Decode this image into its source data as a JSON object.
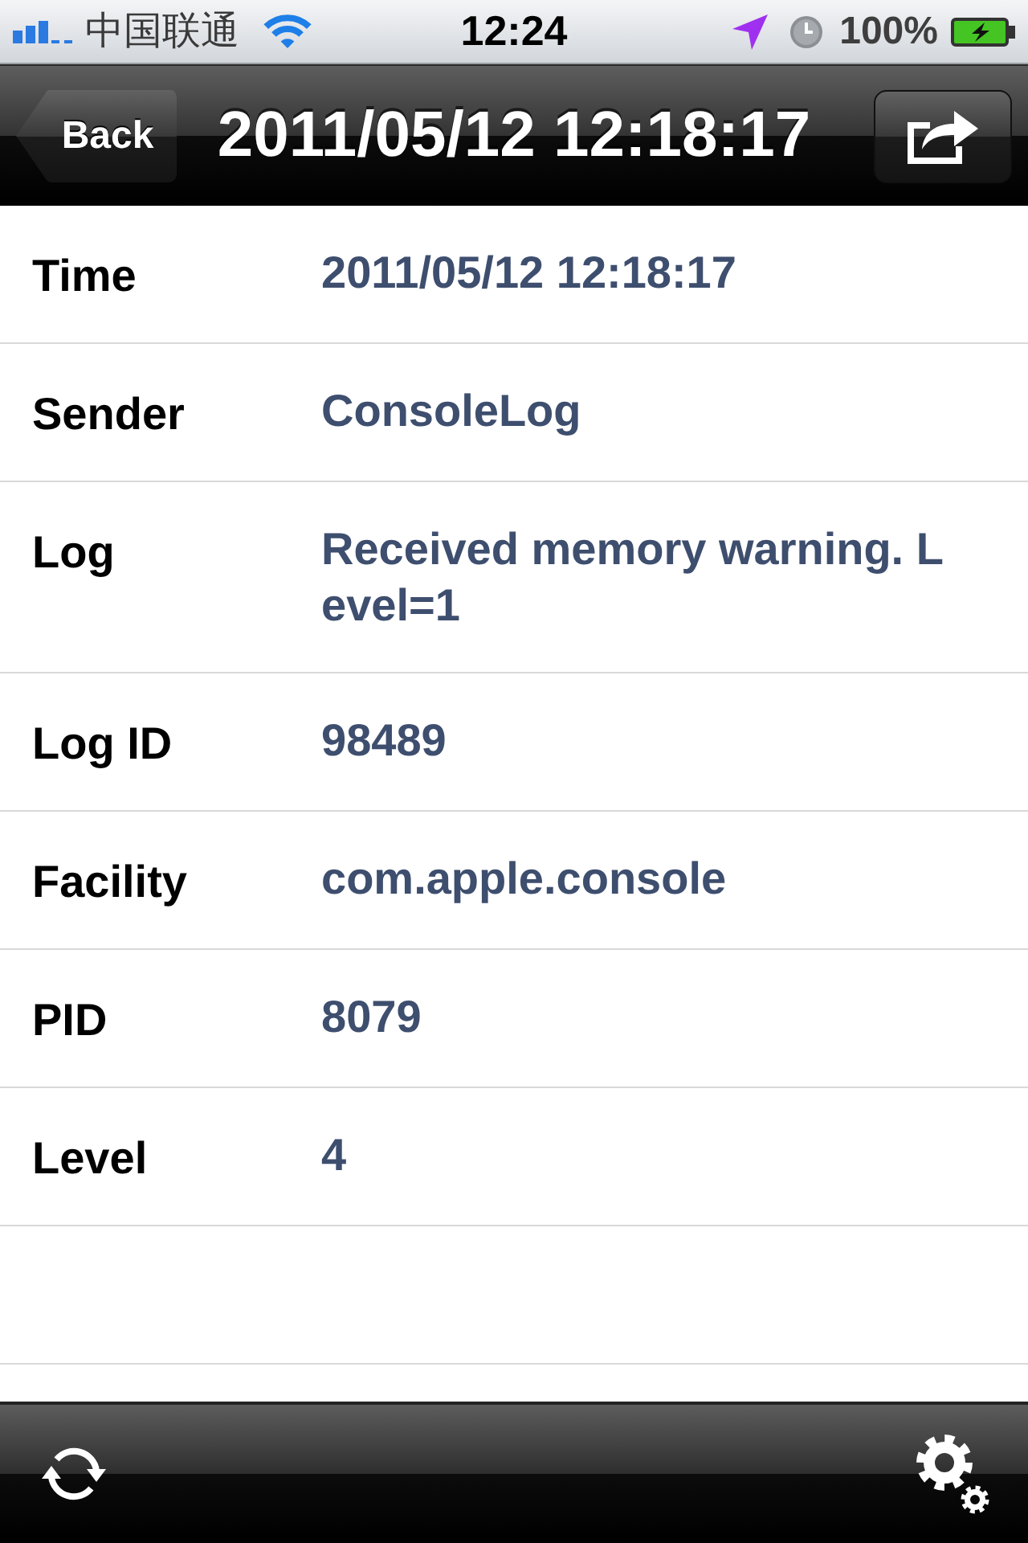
{
  "status_bar": {
    "carrier": "中国联通",
    "time": "12:24",
    "battery": "100%"
  },
  "nav_bar": {
    "back": "Back",
    "title": "2011/05/12 12:18:17"
  },
  "fields": [
    {
      "label": "Time",
      "value": "2011/05/12 12:18:17"
    },
    {
      "label": "Sender",
      "value": "ConsoleLog"
    },
    {
      "label": "Log",
      "value": "Received memory warning. Level=1"
    },
    {
      "label": "Log ID",
      "value": "98489"
    },
    {
      "label": "Facility",
      "value": "com.apple.console"
    },
    {
      "label": "PID",
      "value": "8079"
    },
    {
      "label": "Level",
      "value": "4"
    }
  ]
}
